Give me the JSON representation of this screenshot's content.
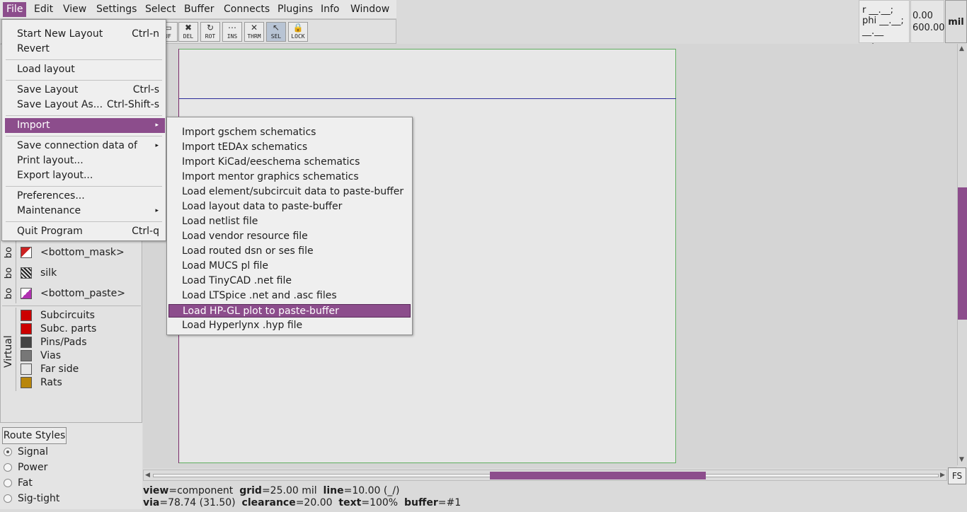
{
  "menubar": [
    "File",
    "Edit",
    "View",
    "Settings",
    "Select",
    "Buffer",
    "Connects",
    "Plugins",
    "Info",
    "Window"
  ],
  "toolbar": {
    "tools": [
      {
        "label": "UF",
        "icon": "buffer-icon"
      },
      {
        "label": "DEL",
        "icon": "delete-icon"
      },
      {
        "label": "ROT",
        "icon": "rotate-icon"
      },
      {
        "label": "INS",
        "icon": "insert-icon"
      },
      {
        "label": "THRM",
        "icon": "thermal-icon"
      },
      {
        "label": "SEL",
        "icon": "select-arrow-icon"
      },
      {
        "label": "LOCK",
        "icon": "lock-icon"
      }
    ]
  },
  "coords": {
    "r_label": "r __.__;",
    "phi_label": "phi __.__;",
    "sep_label": "__.__ __.__",
    "x_value": "0.00",
    "y_value": "600.00",
    "unit": "mil"
  },
  "file_menu": {
    "items": [
      {
        "label": "Start New Layout",
        "accel": "Ctrl-n"
      },
      {
        "label": "Revert",
        "accel": ""
      },
      {
        "label": "Load layout",
        "accel": ""
      },
      {
        "label": "Save Layout",
        "accel": "Ctrl-s"
      },
      {
        "label": "Save Layout As...",
        "accel": "Ctrl-Shift-s"
      },
      {
        "label": "Import",
        "accel": ""
      },
      {
        "label": "Save connection data of",
        "accel": ""
      },
      {
        "label": "Print layout...",
        "accel": ""
      },
      {
        "label": "Export layout...",
        "accel": ""
      },
      {
        "label": "Preferences...",
        "accel": ""
      },
      {
        "label": "Maintenance",
        "accel": ""
      },
      {
        "label": "Quit Program",
        "accel": "Ctrl-q"
      }
    ]
  },
  "import_menu": {
    "items": [
      "Import gschem schematics",
      "Import tEDAx schematics",
      "Import KiCad/eeschema schematics",
      "Import mentor graphics schematics",
      "Load element/subcircuit data to paste-buffer",
      "Load layout data to paste-buffer",
      "Load netlist file",
      "Load vendor resource file",
      "Load routed dsn or ses file",
      "Load MUCS pl file",
      "Load TinyCAD .net file",
      "Load LTSpice .net and .asc files",
      "Load HP-GL plot to paste-buffer",
      "Load Hyperlynx .hyp file"
    ]
  },
  "layers": [
    {
      "group": "bo",
      "name": "<bottom_mask>",
      "color": "#cc2222"
    },
    {
      "group": "bo",
      "name": "silk",
      "color": "#222222"
    },
    {
      "group": "bo",
      "name": "<bottom_paste>",
      "color": "#b030b0"
    }
  ],
  "virtual_layers": {
    "group_label": "Virtual",
    "items": [
      {
        "name": "Subcircuits",
        "color": "#cc0000"
      },
      {
        "name": "Subc. parts",
        "color": "#cc0000"
      },
      {
        "name": "Pins/Pads",
        "color": "#444444"
      },
      {
        "name": "Vias",
        "color": "#777777"
      },
      {
        "name": "Far side",
        "color": "#e6e6e6"
      },
      {
        "name": "Rats",
        "color": "#b8860b"
      }
    ]
  },
  "route_styles": {
    "title": "Route Styles",
    "items": [
      "Signal",
      "Power",
      "Fat",
      "Sig-tight"
    ],
    "selected": "Signal"
  },
  "status": {
    "line1": [
      {
        "key": "view",
        "val": "=component"
      },
      {
        "key": "grid",
        "val": "=25.00 mil"
      },
      {
        "key": "line",
        "val": "=10.00 (_/)"
      }
    ],
    "line2": [
      {
        "key": "via",
        "val": "=78.74 (31.50)"
      },
      {
        "key": "clearance",
        "val": "=20.00"
      },
      {
        "key": "text",
        "val": "=100%"
      },
      {
        "key": "buffer",
        "val": "=#1"
      }
    ],
    "fs_label": "FS"
  }
}
